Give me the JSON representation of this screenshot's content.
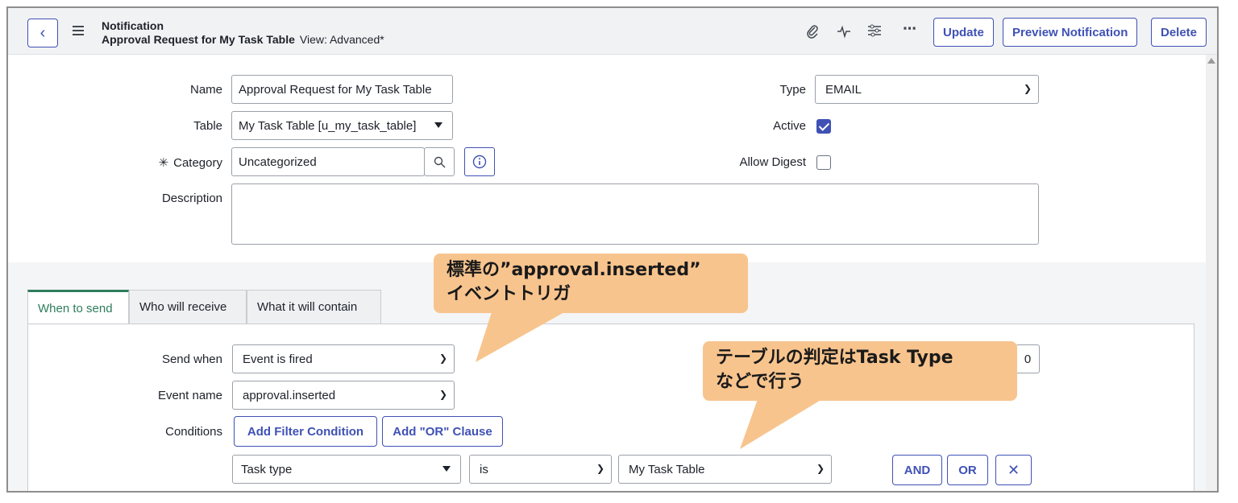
{
  "header": {
    "record_type": "Notification",
    "record_name": "Approval Request for My Task Table",
    "view_label": "View: Advanced*",
    "buttons": {
      "update": "Update",
      "preview": "Preview Notification",
      "delete": "Delete"
    },
    "icons": [
      "back-icon",
      "menu-icon",
      "attachment-icon",
      "activity-icon",
      "settings-icon",
      "more-icon"
    ]
  },
  "form": {
    "name": {
      "label": "Name",
      "value": "Approval Request for My Task Table"
    },
    "table": {
      "label": "Table",
      "value": "My Task Table [u_my_task_table]"
    },
    "category": {
      "required_mark": "✳",
      "label": "Category",
      "value": "Uncategorized"
    },
    "description": {
      "label": "Description",
      "value": ""
    },
    "type": {
      "label": "Type",
      "value": "EMAIL"
    },
    "active": {
      "label": "Active",
      "checked": true
    },
    "allow_digest": {
      "label": "Allow Digest",
      "checked": false
    }
  },
  "tabs": [
    {
      "label": "When to send",
      "active": true
    },
    {
      "label": "Who will receive",
      "active": false
    },
    {
      "label": "What it will contain",
      "active": false
    }
  ],
  "when_to_send": {
    "send_when": {
      "label": "Send when",
      "value": "Event is fired"
    },
    "event_name": {
      "label": "Event name",
      "value": "approval.inserted"
    },
    "conditions": {
      "label": "Conditions",
      "add_filter": "Add Filter Condition",
      "add_or": "Add \"OR\" Clause"
    },
    "condition_row": {
      "field": "Task type",
      "operator": "is",
      "value": "My Task Table",
      "and": "AND",
      "or": "OR"
    },
    "weight_value": "0"
  },
  "callouts": {
    "event": {
      "line1": "標準の”approval.inserted”",
      "line2": "イベントトリガ"
    },
    "table": {
      "line1": "テーブルの判定はTask Type",
      "line2": "などで行う"
    }
  },
  "colors": {
    "accent": "#3f51b5",
    "active_tab": "#2e7d5b",
    "callout": "#f8c48e"
  }
}
